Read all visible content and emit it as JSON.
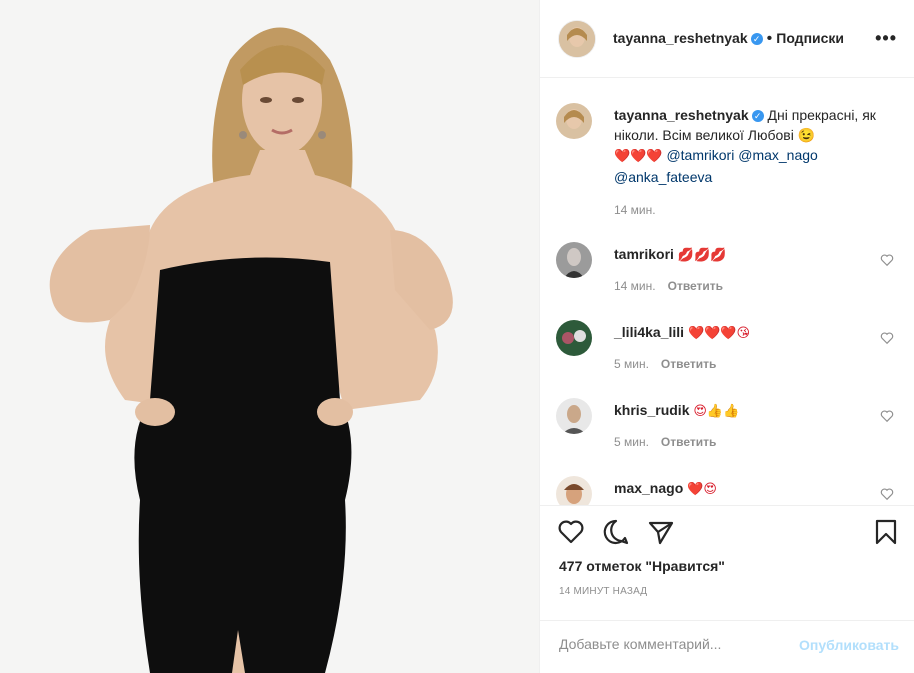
{
  "post": {
    "author": "tayanna_reshetnyak",
    "follow_state": "Подписки",
    "dot": "•",
    "more": "•••",
    "verified_mark": "✓"
  },
  "caption": {
    "author": "tayanna_reshetnyak",
    "text": "Дні прекрасні, як ніколи. Всім великої Любові 😉",
    "hearts": "❤️❤️❤️",
    "mentions": [
      "@tamrikori",
      "@max_nago",
      "@anka_fateeva"
    ],
    "time": "14 мин."
  },
  "comments": [
    {
      "user": "tamrikori",
      "text": "💋💋💋",
      "time": "14 мин.",
      "reply": "Ответить"
    },
    {
      "user": "_lili4ka_lili",
      "text": "❤️❤️❤️😘",
      "time": "5 мин.",
      "reply": "Ответить"
    },
    {
      "user": "khris_rudik",
      "text": "😍👍👍",
      "time": "5 мин.",
      "reply": "Ответить"
    },
    {
      "user": "max_nago",
      "text": "❤️😍",
      "time": "",
      "reply": ""
    }
  ],
  "likes": "477 отметок \"Нравится\"",
  "posted_ago": "14 минут назад",
  "add_comment": {
    "placeholder": "Добавьте комментарий...",
    "publish": "Опубликовать"
  },
  "icons": [
    "heart-icon",
    "comment-icon",
    "share-icon",
    "bookmark-icon"
  ],
  "colors": {
    "accent": "#3897f0",
    "publish_disabled": "#b2dffc",
    "meta": "#8e8e8e"
  }
}
